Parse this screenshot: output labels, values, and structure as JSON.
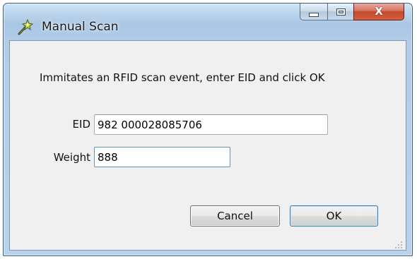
{
  "window": {
    "title": "Manual Scan",
    "icon": "rfid-wand-icon"
  },
  "caption_buttons": {
    "minimize_icon": "minimize-icon",
    "maximize_icon": "maximize-icon",
    "close_label": "X"
  },
  "dialog": {
    "description": "Immitates an RFID scan event, enter EID and click OK",
    "eid_label": "EID",
    "eid_value": "982 000028085706",
    "weight_label": "Weight",
    "weight_value": "888",
    "cancel_label": "Cancel",
    "ok_label": "OK"
  },
  "colors": {
    "title_frame": "#b9d3ec",
    "client_bg": "#f0f0f0",
    "close_button": "#c24a2f",
    "focus_border": "#5c93bc"
  }
}
